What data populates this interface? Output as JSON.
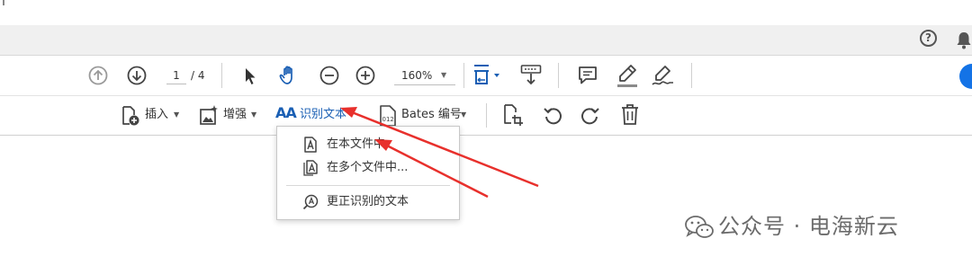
{
  "header": {
    "help_icon": "question-circle-icon",
    "bell_icon": "bell-icon",
    "help_glyph": "?"
  },
  "toolbar1": {
    "page_current": "1",
    "page_total": "/ 4",
    "zoom": "160%",
    "icons": [
      "arrow-up-circle-icon",
      "arrow-down-circle-icon",
      "select-pointer-icon",
      "hand-icon",
      "zoom-out-icon",
      "zoom-in-icon",
      "fit-page-icon",
      "scroll-mode-icon",
      "comment-icon",
      "highlight-pen-icon",
      "sign-icon"
    ]
  },
  "toolbar2": {
    "insert_label": "插入",
    "enhance_label": "增强",
    "ocr_label": "识别文本",
    "ocr_icon_text": "AA",
    "bates_label": "Bates 编号",
    "bates_icon_text": "012",
    "accent_color": "#1a5fb4"
  },
  "ocr_menu": {
    "items": [
      {
        "label": "在本文件中",
        "icon": "document-ocr-icon"
      },
      {
        "label": "在多个文件中...",
        "icon": "documents-ocr-icon"
      },
      {
        "label": "更正识别的文本",
        "icon": "correct-text-icon"
      }
    ]
  },
  "annotation": {
    "arrow_color": "#e8302c"
  },
  "watermark": {
    "text": "公众号 · 电海新云",
    "icon": "wechat-icon"
  }
}
